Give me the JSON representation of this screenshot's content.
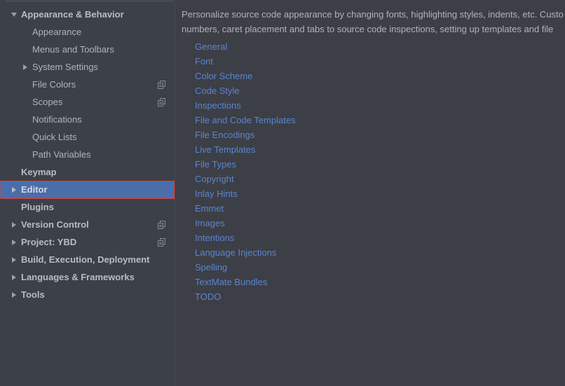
{
  "colors": {
    "sidebar_background": "#3c4049",
    "content_background": "#3c3f46",
    "selection_blue": "#4b6eab",
    "link_blue": "#5c84d0",
    "text_gray": "#b0b3ba",
    "annotation_red": "#e8392c",
    "splitter": "#464a53"
  },
  "sidebar": {
    "name": "settings-category-tree",
    "items": [
      {
        "label": "Appearance & Behavior",
        "level": 0,
        "bold": true,
        "twisty": "down",
        "selected": false,
        "copy_icon": false
      },
      {
        "label": "Appearance",
        "level": 1,
        "bold": false,
        "twisty": "none",
        "selected": false,
        "copy_icon": false
      },
      {
        "label": "Menus and Toolbars",
        "level": 1,
        "bold": false,
        "twisty": "none",
        "selected": false,
        "copy_icon": false
      },
      {
        "label": "System Settings",
        "level": 1,
        "bold": false,
        "twisty": "right",
        "selected": false,
        "copy_icon": false
      },
      {
        "label": "File Colors",
        "level": 1,
        "bold": false,
        "twisty": "none",
        "selected": false,
        "copy_icon": true
      },
      {
        "label": "Scopes",
        "level": 1,
        "bold": false,
        "twisty": "none",
        "selected": false,
        "copy_icon": true
      },
      {
        "label": "Notifications",
        "level": 1,
        "bold": false,
        "twisty": "none",
        "selected": false,
        "copy_icon": false
      },
      {
        "label": "Quick Lists",
        "level": 1,
        "bold": false,
        "twisty": "none",
        "selected": false,
        "copy_icon": false
      },
      {
        "label": "Path Variables",
        "level": 1,
        "bold": false,
        "twisty": "none",
        "selected": false,
        "copy_icon": false
      },
      {
        "label": "Keymap",
        "level": 0,
        "bold": true,
        "twisty": "none",
        "selected": false,
        "copy_icon": false
      },
      {
        "label": "Editor",
        "level": 0,
        "bold": true,
        "twisty": "right",
        "selected": true,
        "copy_icon": false
      },
      {
        "label": "Plugins",
        "level": 0,
        "bold": true,
        "twisty": "none",
        "selected": false,
        "copy_icon": false
      },
      {
        "label": "Version Control",
        "level": 0,
        "bold": true,
        "twisty": "right",
        "selected": false,
        "copy_icon": true
      },
      {
        "label": "Project: YBD",
        "level": 0,
        "bold": true,
        "twisty": "right",
        "selected": false,
        "copy_icon": true
      },
      {
        "label": "Build, Execution, Deployment",
        "level": 0,
        "bold": true,
        "twisty": "right",
        "selected": false,
        "copy_icon": false
      },
      {
        "label": "Languages & Frameworks",
        "level": 0,
        "bold": true,
        "twisty": "right",
        "selected": false,
        "copy_icon": false
      },
      {
        "label": "Tools",
        "level": 0,
        "bold": true,
        "twisty": "right",
        "selected": false,
        "copy_icon": false
      }
    ]
  },
  "content": {
    "description_line_1": "Personalize source code appearance by changing fonts, highlighting styles, indents, etc. Custo",
    "description_line_2": "numbers, caret placement and tabs to source code inspections, setting up templates and file ",
    "links": [
      "General",
      "Font",
      "Color Scheme",
      "Code Style",
      "Inspections",
      "File and Code Templates",
      "File Encodings",
      "Live Templates",
      "File Types",
      "Copyright",
      "Inlay Hints",
      "Emmet",
      "Images",
      "Intentions",
      "Language Injections",
      "Spelling",
      "TextMate Bundles",
      "TODO"
    ]
  },
  "annotation": {
    "target": "Editor",
    "shape": "rectangle"
  }
}
